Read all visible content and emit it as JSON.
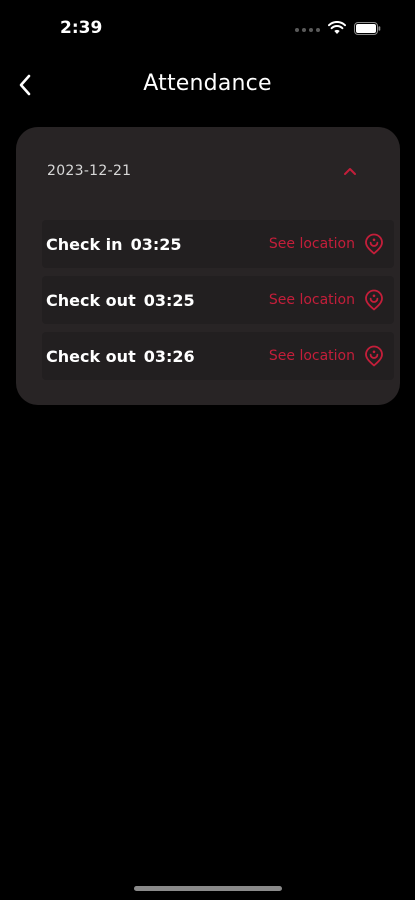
{
  "status_bar": {
    "time": "2:39",
    "icons": [
      "cellular-signal-icon",
      "wifi-icon",
      "battery-icon"
    ]
  },
  "header": {
    "title": "Attendance",
    "back_icon": "chevron-left-icon"
  },
  "attendance_card": {
    "date": "2023-12-21",
    "expanded": true,
    "toggle_icon": "chevron-up-icon",
    "records": [
      {
        "label": "Check in",
        "time": "03:25",
        "action": "See location",
        "icon": "location-pin-icon"
      },
      {
        "label": "Check out",
        "time": "03:25",
        "action": "See location",
        "icon": "location-pin-icon"
      },
      {
        "label": "Check out",
        "time": "03:26",
        "action": "See location",
        "icon": "location-pin-icon"
      }
    ]
  },
  "colors": {
    "background": "#000000",
    "card": "#282425",
    "row": "#221f20",
    "accent": "#c41e3a",
    "text": "#ffffff"
  }
}
